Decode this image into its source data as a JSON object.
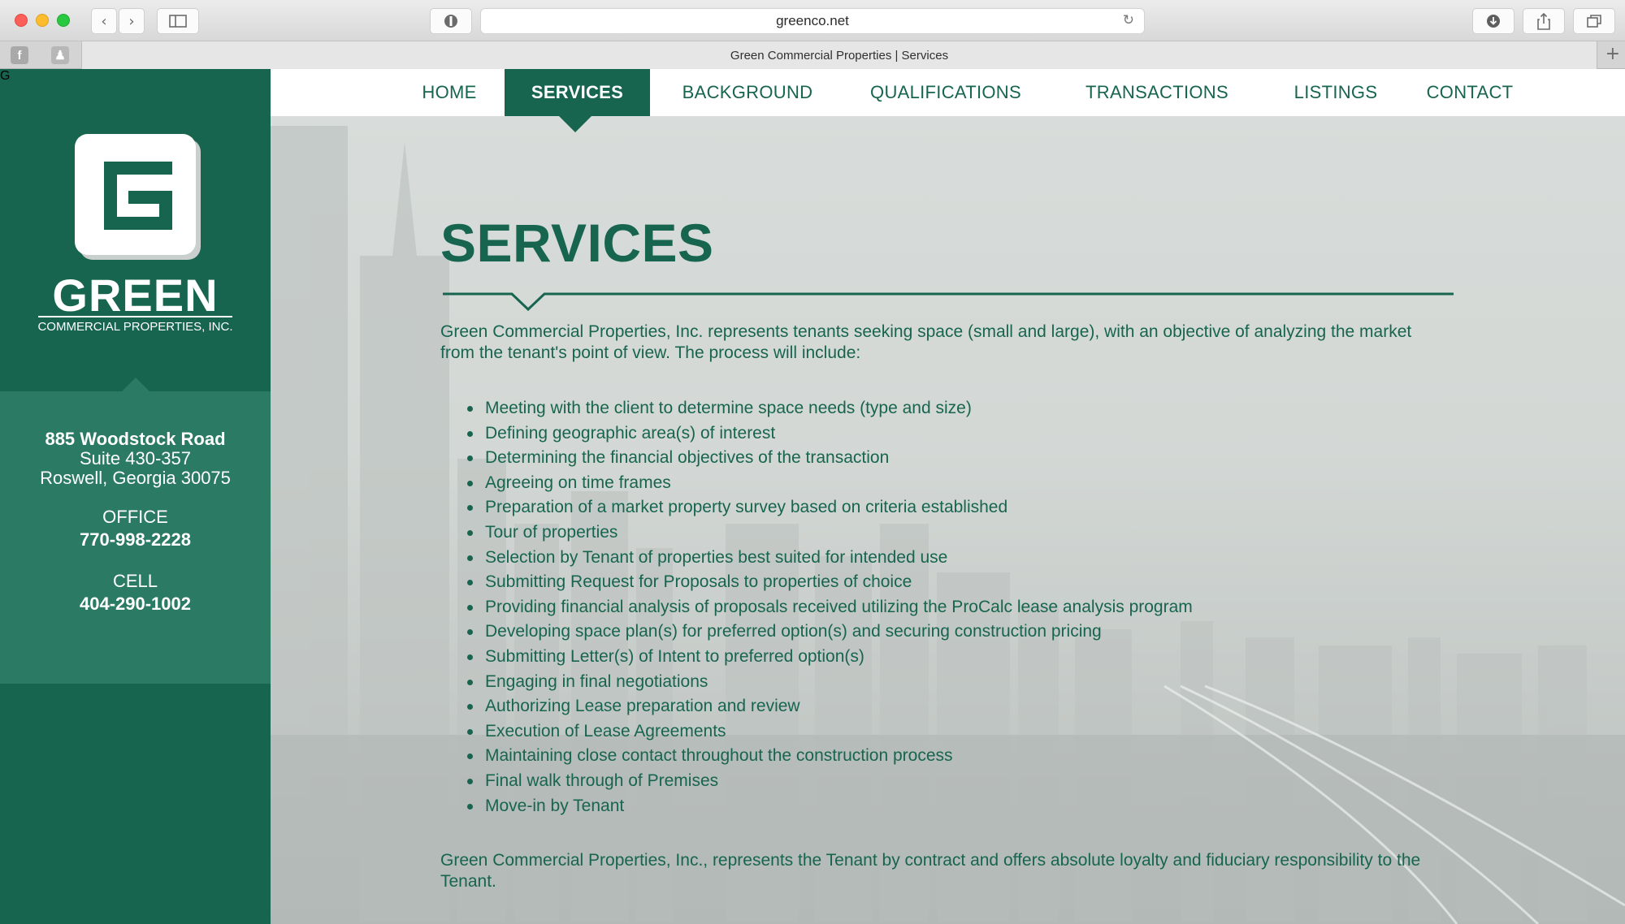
{
  "browser": {
    "url": "greenco.net",
    "tab_title": "Green Commercial Properties | Services"
  },
  "logo": {
    "letter": "G",
    "word": "GREEN",
    "subtitle": "COMMERCIAL PROPERTIES, INC."
  },
  "contact": {
    "street": "885 Woodstock Road",
    "suite": "Suite 430-357",
    "city": "Roswell, Georgia 30075",
    "office_label": "OFFICE",
    "office_phone": "770-998-2228",
    "cell_label": "CELL",
    "cell_phone": "404-290-1002"
  },
  "nav": {
    "items": [
      {
        "label": "HOME"
      },
      {
        "label": "SERVICES"
      },
      {
        "label": "BACKGROUND"
      },
      {
        "label": "QUALIFICATIONS"
      },
      {
        "label": "TRANSACTIONS"
      },
      {
        "label": "LISTINGS"
      },
      {
        "label": "CONTACT"
      }
    ],
    "active": "SERVICES"
  },
  "main": {
    "title": "SERVICES",
    "intro": "Green Commercial Properties, Inc. represents tenants seeking space (small and large), with an objective of analyzing the market from the tenant's point of view. The process will include:",
    "services": [
      "Meeting with the client to determine space needs (type and size)",
      "Defining geographic area(s) of interest",
      "Determining the financial objectives of the transaction",
      "Agreeing on time frames",
      "Preparation of a market property survey based on criteria established",
      "Tour of properties",
      "Selection by Tenant of properties best suited for intended use",
      "Submitting Request for Proposals to properties of choice",
      "Providing financial analysis of proposals received utilizing the ProCalc lease analysis program",
      "Developing space plan(s) for preferred option(s) and securing construction pricing",
      "Submitting Letter(s) of Intent to preferred option(s)",
      "Engaging in final negotiations",
      "Authorizing Lease preparation and review",
      "Execution of Lease Agreements",
      "Maintaining close contact throughout the construction process",
      "Final walk through of Premises",
      "Move-in by Tenant"
    ],
    "outro": "Green Commercial Properties, Inc., represents the Tenant by contract and offers absolute loyalty and fiduciary responsibility to the Tenant."
  },
  "colors": {
    "brand_green": "#17654f",
    "contact_panel": "#2b7a63",
    "nav_bg": "#ffffff"
  }
}
